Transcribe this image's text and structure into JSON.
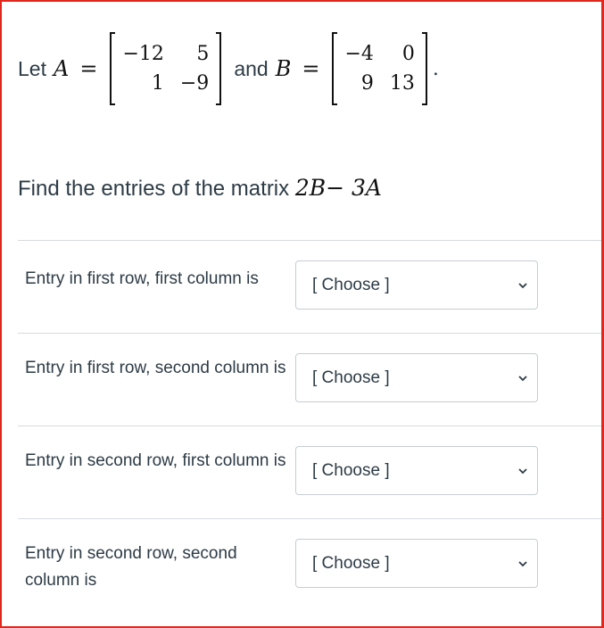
{
  "question": {
    "let_text": "Let",
    "a_symbol": "A",
    "equals": "=",
    "matrix_a": [
      "−12",
      "5",
      "1",
      "−9"
    ],
    "and_text": "and",
    "b_symbol": "B",
    "matrix_b": [
      "−4",
      "0",
      "9",
      "13"
    ],
    "period": ".",
    "find_text": "Find the entries of the matrix",
    "expression": "2B− 3A"
  },
  "entries": [
    {
      "label": "Entry in first row, first column is",
      "selected": "[ Choose ]"
    },
    {
      "label": "Entry in first row, second column is",
      "selected": "[ Choose ]"
    },
    {
      "label": "Entry in second row, first column is",
      "selected": "[ Choose ]"
    },
    {
      "label": "Entry in second row, second column is",
      "selected": "[ Choose ]"
    }
  ],
  "icons": {
    "dropdown": "chevron-down-icon"
  },
  "colors": {
    "frame_border": "#e0281e",
    "text": "#2d3b45",
    "divider": "#d7dbdf",
    "select_border": "#c7cdd1"
  }
}
